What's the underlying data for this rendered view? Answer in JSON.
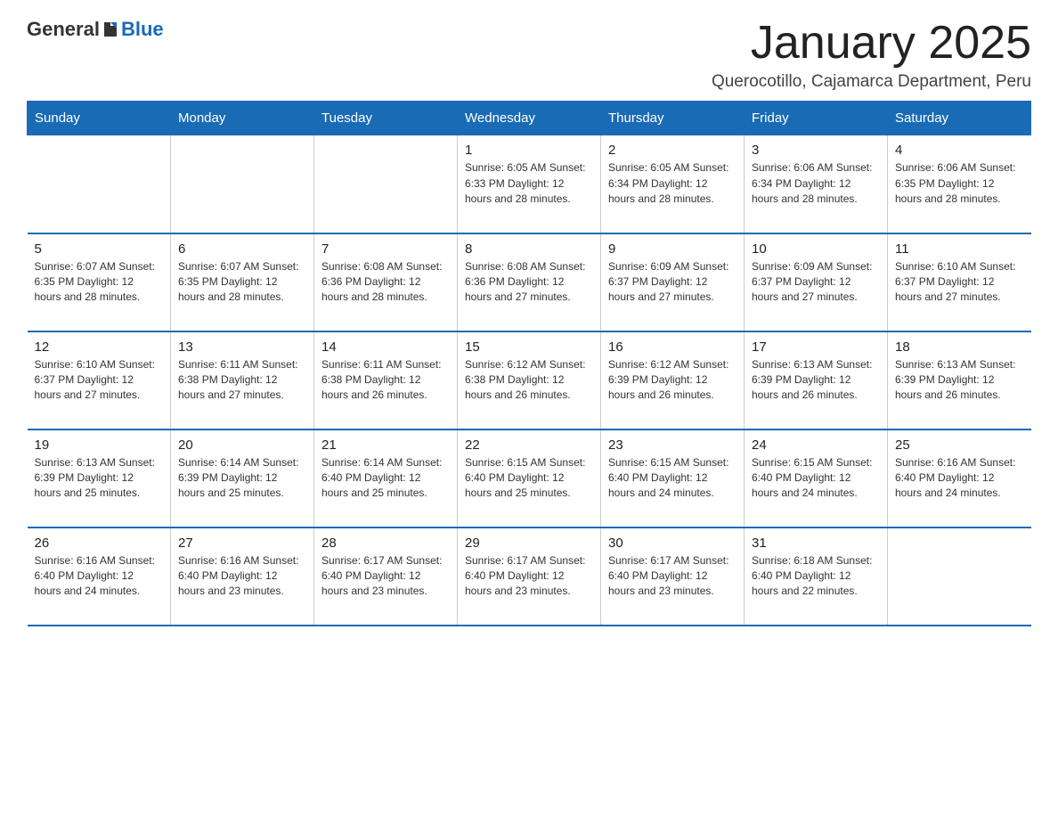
{
  "logo": {
    "general": "General",
    "blue": "Blue"
  },
  "header": {
    "title": "January 2025",
    "location": "Querocotillo, Cajamarca Department, Peru"
  },
  "weekdays": [
    "Sunday",
    "Monday",
    "Tuesday",
    "Wednesday",
    "Thursday",
    "Friday",
    "Saturday"
  ],
  "weeks": [
    [
      {
        "day": "",
        "info": ""
      },
      {
        "day": "",
        "info": ""
      },
      {
        "day": "",
        "info": ""
      },
      {
        "day": "1",
        "info": "Sunrise: 6:05 AM\nSunset: 6:33 PM\nDaylight: 12 hours\nand 28 minutes."
      },
      {
        "day": "2",
        "info": "Sunrise: 6:05 AM\nSunset: 6:34 PM\nDaylight: 12 hours\nand 28 minutes."
      },
      {
        "day": "3",
        "info": "Sunrise: 6:06 AM\nSunset: 6:34 PM\nDaylight: 12 hours\nand 28 minutes."
      },
      {
        "day": "4",
        "info": "Sunrise: 6:06 AM\nSunset: 6:35 PM\nDaylight: 12 hours\nand 28 minutes."
      }
    ],
    [
      {
        "day": "5",
        "info": "Sunrise: 6:07 AM\nSunset: 6:35 PM\nDaylight: 12 hours\nand 28 minutes."
      },
      {
        "day": "6",
        "info": "Sunrise: 6:07 AM\nSunset: 6:35 PM\nDaylight: 12 hours\nand 28 minutes."
      },
      {
        "day": "7",
        "info": "Sunrise: 6:08 AM\nSunset: 6:36 PM\nDaylight: 12 hours\nand 28 minutes."
      },
      {
        "day": "8",
        "info": "Sunrise: 6:08 AM\nSunset: 6:36 PM\nDaylight: 12 hours\nand 27 minutes."
      },
      {
        "day": "9",
        "info": "Sunrise: 6:09 AM\nSunset: 6:37 PM\nDaylight: 12 hours\nand 27 minutes."
      },
      {
        "day": "10",
        "info": "Sunrise: 6:09 AM\nSunset: 6:37 PM\nDaylight: 12 hours\nand 27 minutes."
      },
      {
        "day": "11",
        "info": "Sunrise: 6:10 AM\nSunset: 6:37 PM\nDaylight: 12 hours\nand 27 minutes."
      }
    ],
    [
      {
        "day": "12",
        "info": "Sunrise: 6:10 AM\nSunset: 6:37 PM\nDaylight: 12 hours\nand 27 minutes."
      },
      {
        "day": "13",
        "info": "Sunrise: 6:11 AM\nSunset: 6:38 PM\nDaylight: 12 hours\nand 27 minutes."
      },
      {
        "day": "14",
        "info": "Sunrise: 6:11 AM\nSunset: 6:38 PM\nDaylight: 12 hours\nand 26 minutes."
      },
      {
        "day": "15",
        "info": "Sunrise: 6:12 AM\nSunset: 6:38 PM\nDaylight: 12 hours\nand 26 minutes."
      },
      {
        "day": "16",
        "info": "Sunrise: 6:12 AM\nSunset: 6:39 PM\nDaylight: 12 hours\nand 26 minutes."
      },
      {
        "day": "17",
        "info": "Sunrise: 6:13 AM\nSunset: 6:39 PM\nDaylight: 12 hours\nand 26 minutes."
      },
      {
        "day": "18",
        "info": "Sunrise: 6:13 AM\nSunset: 6:39 PM\nDaylight: 12 hours\nand 26 minutes."
      }
    ],
    [
      {
        "day": "19",
        "info": "Sunrise: 6:13 AM\nSunset: 6:39 PM\nDaylight: 12 hours\nand 25 minutes."
      },
      {
        "day": "20",
        "info": "Sunrise: 6:14 AM\nSunset: 6:39 PM\nDaylight: 12 hours\nand 25 minutes."
      },
      {
        "day": "21",
        "info": "Sunrise: 6:14 AM\nSunset: 6:40 PM\nDaylight: 12 hours\nand 25 minutes."
      },
      {
        "day": "22",
        "info": "Sunrise: 6:15 AM\nSunset: 6:40 PM\nDaylight: 12 hours\nand 25 minutes."
      },
      {
        "day": "23",
        "info": "Sunrise: 6:15 AM\nSunset: 6:40 PM\nDaylight: 12 hours\nand 24 minutes."
      },
      {
        "day": "24",
        "info": "Sunrise: 6:15 AM\nSunset: 6:40 PM\nDaylight: 12 hours\nand 24 minutes."
      },
      {
        "day": "25",
        "info": "Sunrise: 6:16 AM\nSunset: 6:40 PM\nDaylight: 12 hours\nand 24 minutes."
      }
    ],
    [
      {
        "day": "26",
        "info": "Sunrise: 6:16 AM\nSunset: 6:40 PM\nDaylight: 12 hours\nand 24 minutes."
      },
      {
        "day": "27",
        "info": "Sunrise: 6:16 AM\nSunset: 6:40 PM\nDaylight: 12 hours\nand 23 minutes."
      },
      {
        "day": "28",
        "info": "Sunrise: 6:17 AM\nSunset: 6:40 PM\nDaylight: 12 hours\nand 23 minutes."
      },
      {
        "day": "29",
        "info": "Sunrise: 6:17 AM\nSunset: 6:40 PM\nDaylight: 12 hours\nand 23 minutes."
      },
      {
        "day": "30",
        "info": "Sunrise: 6:17 AM\nSunset: 6:40 PM\nDaylight: 12 hours\nand 23 minutes."
      },
      {
        "day": "31",
        "info": "Sunrise: 6:18 AM\nSunset: 6:40 PM\nDaylight: 12 hours\nand 22 minutes."
      },
      {
        "day": "",
        "info": ""
      }
    ]
  ]
}
